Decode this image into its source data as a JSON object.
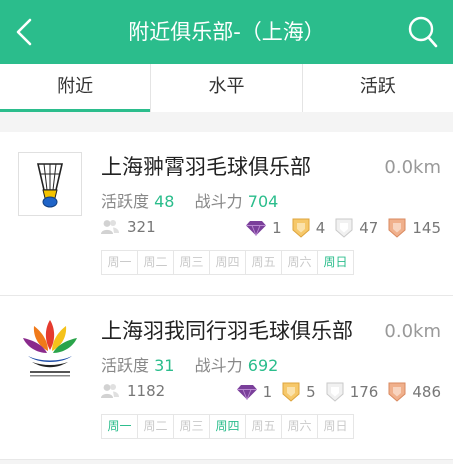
{
  "header": {
    "title": "附近俱乐部-（上海）"
  },
  "tabs": [
    {
      "label": "附近",
      "active": true
    },
    {
      "label": "水平",
      "active": false
    },
    {
      "label": "活跃",
      "active": false
    }
  ],
  "clubs": [
    {
      "name": "上海翀霄羽毛球俱乐部",
      "distance": "0.0km",
      "activity_label": "活跃度",
      "activity": "48",
      "power_label": "战斗力",
      "power": "704",
      "members": "321",
      "medals": {
        "diamond": "1",
        "gold": "4",
        "silver": "47",
        "bronze": "145"
      },
      "days": [
        "周一",
        "周二",
        "周三",
        "周四",
        "周五",
        "周六",
        "周日"
      ],
      "active_days": [
        false,
        false,
        false,
        false,
        false,
        false,
        true
      ]
    },
    {
      "name": "上海羽我同行羽毛球俱乐部",
      "distance": "0.0km",
      "activity_label": "活跃度",
      "activity": "31",
      "power_label": "战斗力",
      "power": "692",
      "members": "1182",
      "medals": {
        "diamond": "1",
        "gold": "5",
        "silver": "176",
        "bronze": "486"
      },
      "days": [
        "周一",
        "周二",
        "周三",
        "周四",
        "周五",
        "周六",
        "周日"
      ],
      "active_days": [
        true,
        false,
        false,
        true,
        false,
        false,
        false
      ]
    }
  ],
  "colors": {
    "accent": "#2bbd8c",
    "diamond": "#7a3f9a",
    "gold": "#f0b44a",
    "silver": "#d8d8d8",
    "bronze": "#e6a07a"
  }
}
